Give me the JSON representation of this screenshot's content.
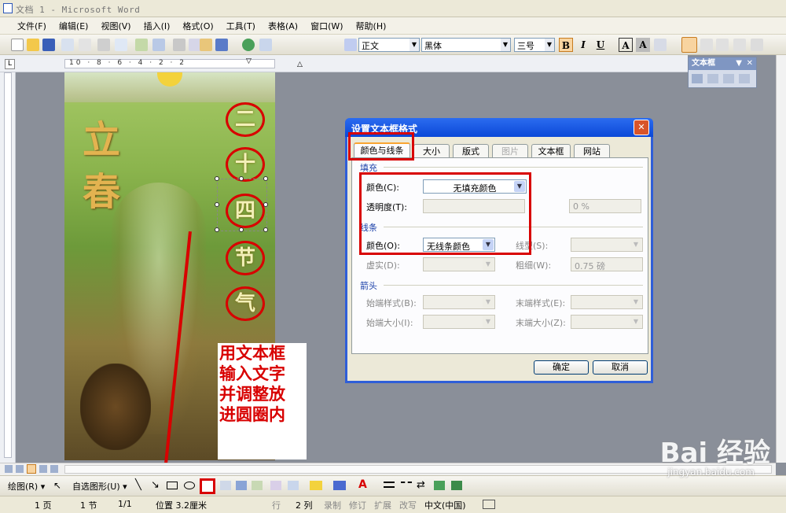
{
  "window": {
    "title": "文档 1 - Microsoft Word"
  },
  "menu": [
    "文件(F)",
    "编辑(E)",
    "视图(V)",
    "插入(I)",
    "格式(O)",
    "工具(T)",
    "表格(A)",
    "窗口(W)"
  ],
  "menu_help": "帮助(H)",
  "format_toolbar": {
    "style": "正文",
    "font": "黑体",
    "size": "三号",
    "bold": "B",
    "italic": "I",
    "underline": "U",
    "char_border": "A",
    "char_shade": "A"
  },
  "ruler": {
    "ticks": "10 · 8 · 6 · 4 · 2 · 2"
  },
  "document": {
    "lichun": [
      "立",
      "春"
    ],
    "circles": [
      "二",
      "十",
      "四",
      "节",
      "气"
    ],
    "note_lines": [
      "用文本框",
      "输入文字",
      "并调整放",
      "进圆圈内"
    ]
  },
  "textbox_panel": {
    "title": "文本框"
  },
  "dialog": {
    "title": "设置文本框格式",
    "tabs": [
      "颜色与线条",
      "大小",
      "版式",
      "图片",
      "文本框",
      "网站"
    ],
    "fill": {
      "heading": "填充",
      "color_label": "颜色(C):",
      "color_value": "无填充颜色",
      "transparency_label": "透明度(T):",
      "transparency_value": "0 %"
    },
    "line": {
      "heading": "线条",
      "color_label": "颜色(O):",
      "color_value": "无线条颜色",
      "style_label": "线型(S):",
      "dash_label": "虚实(D):",
      "weight_label": "粗细(W):",
      "weight_value": "0.75 磅"
    },
    "arrows": {
      "heading": "箭头",
      "begin_style": "始端样式(B):",
      "end_style": "末端样式(E):",
      "begin_size": "始端大小(I):",
      "end_size": "末端大小(Z):"
    },
    "ok": "确定",
    "cancel": "取消"
  },
  "drawing_toolbar": {
    "draw": "绘图(R) ▾",
    "autoshapes": "自选图形(U) ▾"
  },
  "status": {
    "page": "1 页",
    "section": "1 节",
    "pages": "1/1",
    "position": "位置 3.2厘米",
    "line": "行",
    "col": "2 列",
    "rec": "录制",
    "trk": "修订",
    "ext": "扩展",
    "ovr": "改写",
    "lang": "中文(中国)"
  },
  "watermark": {
    "brand": "Bai 经验",
    "url": "jingyan.baidu.com"
  },
  "colors": {
    "annotation_red": "#d80000",
    "dialog_blue": "#0b48d8"
  }
}
